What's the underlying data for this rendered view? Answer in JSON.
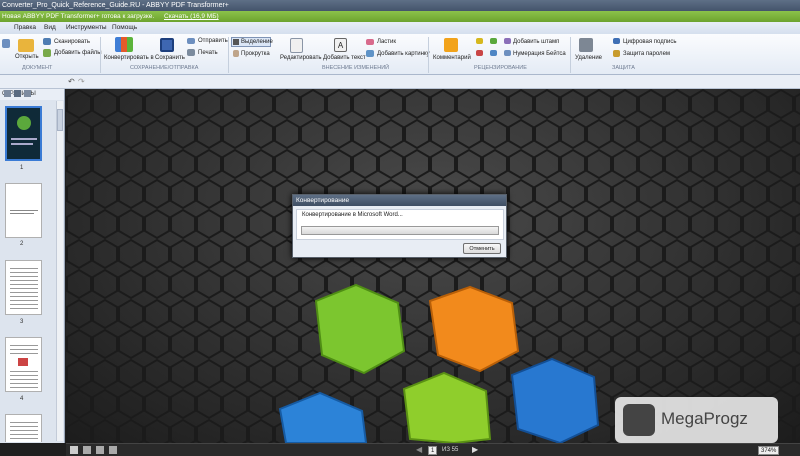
{
  "window": {
    "title": "Converter_Pro_Quick_Reference_Guide.RU - ABBYY PDF Transformer+"
  },
  "notification": {
    "text": "Новая ABBYY PDF Transformer+ готова к загрузке.",
    "link": "Скачать (16,9 МБ)"
  },
  "menu": [
    "Правка",
    "Вид",
    "Инструменты",
    "Помощь"
  ],
  "ribbon": {
    "scan": "Сканировать",
    "add_files": "Добавить файлы",
    "open": "Открыть",
    "convert": "Конвертировать в",
    "save": "Сохранить",
    "send": "Отправить",
    "print": "Печать",
    "select": "Выделение",
    "scroll": "Прокрутка",
    "edit": "Редактировать",
    "add_text": "Добавить текст",
    "eraser": "Ластик",
    "add_image": "Добавить картинку",
    "comment": "Комментарий",
    "add_stamp": "Добавить штамп",
    "bates": "Нумерация Бейтса",
    "delete": "Удаление",
    "signature": "Цифровая подпись",
    "password": "Защита паролем",
    "groups": {
      "document": "ДОКУМЕНТ",
      "save_send": "СОХРАНЕНИЕ/ОТПРАВКА",
      "changes": "ВНЕСЕНИЕ ИЗМЕНЕНИЙ",
      "review": "РЕЦЕНЗИРОВАНИЕ",
      "protect": "ЗАЩИТА"
    }
  },
  "sidebar": {
    "header": "СТРАНИЦЫ",
    "pages": [
      "1",
      "2",
      "3",
      "4"
    ]
  },
  "dialog": {
    "title": "Конвертирование",
    "message": "Конвертирование в Microsoft Word...",
    "cancel": "Отменить"
  },
  "status": {
    "page": "1",
    "of": "ИЗ 55",
    "zoom": "374%"
  },
  "watermark": {
    "text": "MegaProgz"
  },
  "colors": {
    "accent": "#6da32e",
    "titlebar": "#44546b",
    "background": "#2e2e2e"
  }
}
